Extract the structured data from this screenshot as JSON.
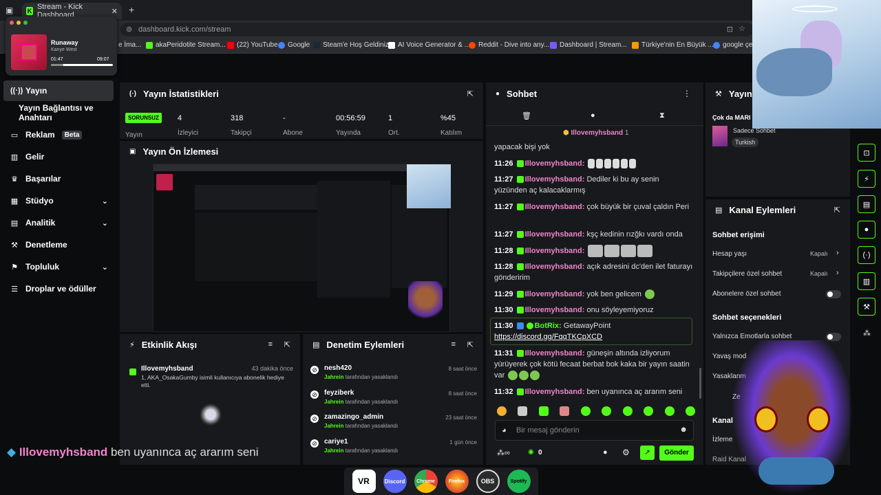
{
  "browser": {
    "tab_title": "Stream - Kick Dashboard",
    "url": "dashboard.kick.com/stream",
    "bookmarks": [
      "e İma...",
      "akaPeridotite Stream...",
      "(22) YouTube",
      "Google",
      "Steam'e Hoş Geldiniz",
      "AI Voice Generator & ...",
      "Reddit - Dive into any...",
      "Dashboard | Stream...",
      "Türkiye'nin En Büyük ...",
      "google çev"
    ]
  },
  "music": {
    "title": "Runaway",
    "artist": "Kanye West",
    "elapsed": "01:47",
    "duration": "09:07",
    "progress": 0.2
  },
  "sidebar": {
    "items": [
      {
        "label": "Yayın",
        "icon": "broadcast-icon"
      },
      {
        "label": "Yayın Bağlantısı ve Anahtarı"
      },
      {
        "label": "Reklam",
        "badge": "Beta",
        "icon": "ad-icon"
      },
      {
        "label": "Gelir",
        "icon": "revenue-icon"
      },
      {
        "label": "Başarılar",
        "icon": "trophy-icon"
      },
      {
        "label": "Stüdyo",
        "icon": "studio-icon"
      },
      {
        "label": "Analitik",
        "icon": "analytics-icon"
      },
      {
        "label": "Denetleme",
        "icon": "wrench-icon"
      },
      {
        "label": "Topluluk",
        "icon": "community-icon"
      },
      {
        "label": "Droplar ve ödüller",
        "icon": "drops-icon"
      }
    ]
  },
  "stats": {
    "title": "Yayın İstatistikleri",
    "status": "SORUNSUZ",
    "status_label": "Yayın",
    "items": [
      {
        "value": "4",
        "label": "İzleyici"
      },
      {
        "value": "318",
        "label": "Takipçi"
      },
      {
        "value": "-",
        "label": "Abone"
      },
      {
        "value": "00:56:59",
        "label": "Yayında"
      },
      {
        "value": "1",
        "label": "Ort."
      },
      {
        "value": "%45",
        "label": "Katılım"
      }
    ]
  },
  "preview": {
    "title": "Yayın Ön İzlemesi"
  },
  "activity": {
    "title": "Etkinlik Akışı",
    "user": "Illovemyhsband",
    "time": "43 dakika önce",
    "text": "1, AKA_OsakaGumby isimli kullanıcıya abonelik hediye etti."
  },
  "moderation": {
    "title": "Denetim Eylemleri",
    "items": [
      {
        "user": "nesh420",
        "by": "Jahrein",
        "action": "tarafından yasaklandı",
        "time": "8 saat önce"
      },
      {
        "user": "feyziberk",
        "by": "Jahrein",
        "action": "tarafından yasaklandı",
        "time": "8 saat önce"
      },
      {
        "user": "zamazingo_admin",
        "by": "Jahrein",
        "action": "tarafından yasaklandı",
        "time": "23 saat önce"
      },
      {
        "user": "cariye1",
        "by": "Jahrein",
        "action": "tarafından yasaklandı",
        "time": "1 gün önce"
      }
    ]
  },
  "chat": {
    "title": "Sohbet",
    "pinned_user": "Illovemyhsband",
    "pinned_count": "1",
    "messages": [
      {
        "time": "",
        "user": "",
        "text": "yapacak bişi yok"
      },
      {
        "time": "11:26",
        "user": "Illovemyhsband:",
        "text": ""
      },
      {
        "time": "11:27",
        "user": "Illovemyhsband:",
        "text": "Dediler ki bu ay senin yüzünden aç kalacaklarmış"
      },
      {
        "time": "11:27",
        "user": "Illovemyhsband:",
        "text": "çok büyük bir çuval çaldın Peri"
      },
      {
        "time": "11:27",
        "user": "Illovemyhsband:",
        "text": "kşç kedinin rızğkı vardı onda"
      },
      {
        "time": "11:28",
        "user": "Illovemyhsband:",
        "text": ""
      },
      {
        "time": "11:28",
        "user": "Illovemyhsband:",
        "text": "açık adresini dc'den ilet faturayı gönderirim"
      },
      {
        "time": "11:29",
        "user": "Illovemyhsband:",
        "text": "yok ben gelicem"
      },
      {
        "time": "11:30",
        "user": "Illovemyhsband:",
        "text": "onu söyleyemiyoruz"
      },
      {
        "time": "11:30",
        "user": "BotRix:",
        "text": "GetawayPoint",
        "link": "https://discord.gg/FqqTKCpXCD"
      },
      {
        "time": "11:31",
        "user": "Illovemyhsband:",
        "text": "güneşin altında izliyorum yürüyerek çok kötü fecaat berbat bok kaka bir yayın saatin var"
      },
      {
        "time": "11:32",
        "user": "Illovemyhsband:",
        "text": "ben uyanınca aç ararım seni"
      }
    ],
    "placeholder": "Bir mesaj gönderin",
    "send_label": "Gönder",
    "points": "0"
  },
  "right": {
    "top_title": "Yayın",
    "top_section": "Çok da MARI",
    "category": "Sadece Sohbet",
    "language": "Turkish",
    "actions_title": "Kanal Eylemleri",
    "access_title": "Sohbet erişimi",
    "account_age": "Hesap yaşı",
    "account_age_val": "Kapalı",
    "follower_chat": "Takipçilere özel sohbet",
    "follower_chat_val": "Kapalı",
    "sub_chat": "Abonelere özel sohbet",
    "options_title": "Sohbet seçenekleri",
    "emote_only": "Yalnızca Emotlarla sohbet",
    "slow_mode": "Yavaş mod",
    "banned": "Yasaklanm",
    "z_row": "Ze",
    "channel": "Kanal",
    "watch": "İzleme",
    "raid": "Raid Kanal"
  },
  "overlay": {
    "user": "Illovemyhsband",
    "text": "ben uyanınca aç ararım seni"
  },
  "taskbar": [
    "VR",
    "Discord",
    "Chrome",
    "Firefox",
    "OBS",
    "Spotify"
  ],
  "colors": {
    "accent": "#53fc18",
    "username": "#f084c9",
    "panel": "#18191c"
  }
}
